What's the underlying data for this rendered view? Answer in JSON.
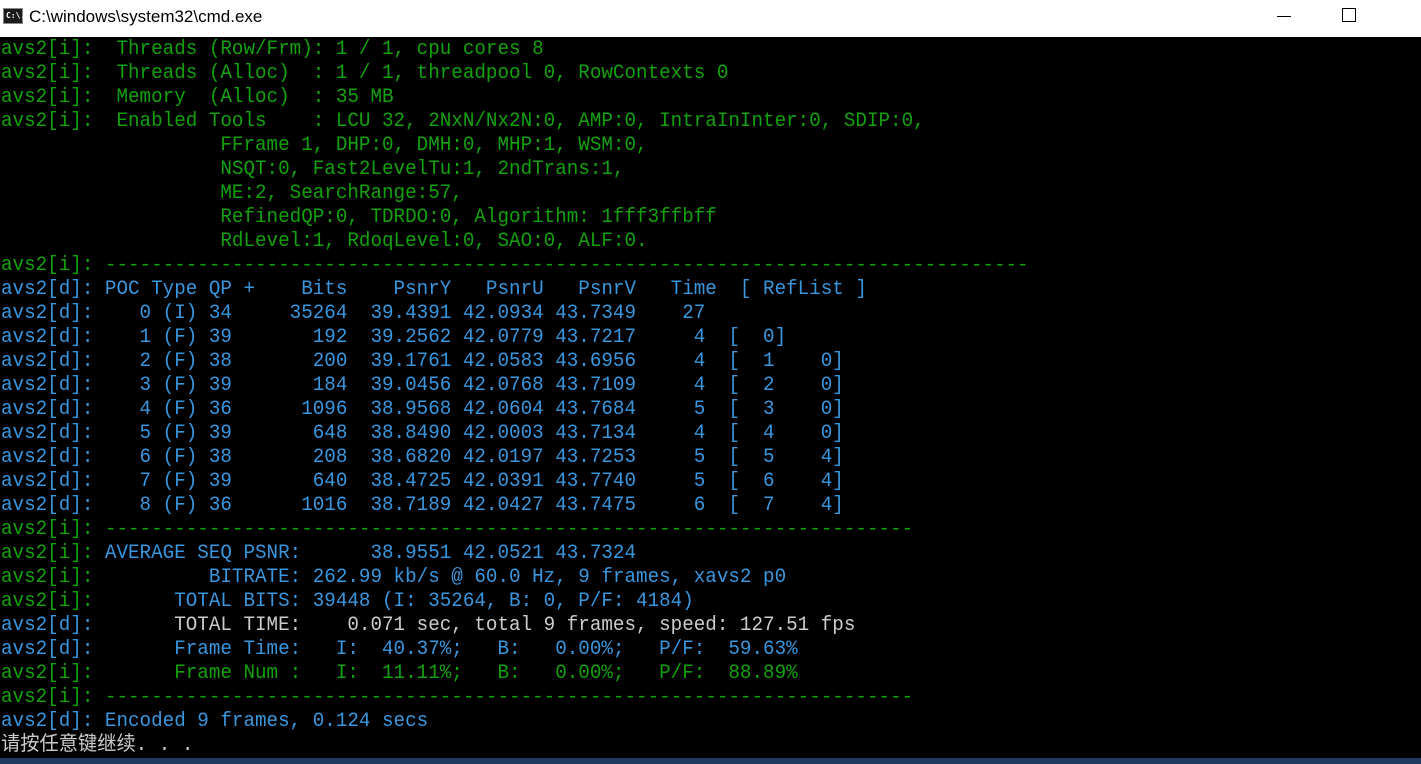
{
  "window": {
    "title": "C:\\windows\\system32\\cmd.exe",
    "icon": "cmd-icon",
    "icon_glyph": "C:\\."
  },
  "colors": {
    "bright_green": "#13a10e",
    "cyan": "#3a96dd",
    "white": "#cccccc",
    "green": "#13a10e"
  },
  "console": {
    "lines": [
      {
        "text": "avs2[i]:  Threads (Row/Frm): 1 / 1, cpu cores 8",
        "color": "#13a10e"
      },
      {
        "text": "avs2[i]:  Threads (Alloc)  : 1 / 1, threadpool 0, RowContexts 0",
        "color": "#13a10e"
      },
      {
        "text": "avs2[i]:  Memory  (Alloc)  : 35 MB",
        "color": "#13a10e"
      },
      {
        "text": "avs2[i]:  Enabled Tools    : LCU 32, 2NxN/Nx2N:0, AMP:0, IntraInInter:0, SDIP:0,",
        "color": "#13a10e"
      },
      {
        "text": "                   FFrame 1, DHP:0, DMH:0, MHP:1, WSM:0,",
        "color": "#13a10e"
      },
      {
        "text": "                   NSQT:0, Fast2LevelTu:1, 2ndTrans:1,",
        "color": "#13a10e"
      },
      {
        "text": "                   ME:2, SearchRange:57,",
        "color": "#13a10e"
      },
      {
        "text": "                   RefinedQP:0, TDRDO:0, Algorithm: 1fff3ffbff",
        "color": "#13a10e"
      },
      {
        "text": "                   RdLevel:1, RdoqLevel:0, SAO:0, ALF:0.",
        "color": "#13a10e"
      },
      {
        "text": "avs2[i]: --------------------------------------------------------------------------------",
        "color": "#13a10e"
      },
      {
        "text": "avs2[d]: POC Type QP +    Bits    PsnrY   PsnrU   PsnrV   Time  [ RefList ]",
        "color": "#3a96dd"
      },
      {
        "text": "avs2[d]:    0 (I) 34     35264  39.4391 42.0934 43.7349    27",
        "color": "#3a96dd"
      },
      {
        "text": "avs2[d]:    1 (F) 39       192  39.2562 42.0779 43.7217     4  [  0]",
        "color": "#3a96dd"
      },
      {
        "text": "avs2[d]:    2 (F) 38       200  39.1761 42.0583 43.6956     4  [  1    0]",
        "color": "#3a96dd"
      },
      {
        "text": "avs2[d]:    3 (F) 39       184  39.0456 42.0768 43.7109     4  [  2    0]",
        "color": "#3a96dd"
      },
      {
        "text": "avs2[d]:    4 (F) 36      1096  38.9568 42.0604 43.7684     5  [  3    0]",
        "color": "#3a96dd"
      },
      {
        "text": "avs2[d]:    5 (F) 39       648  38.8490 42.0003 43.7134     4  [  4    0]",
        "color": "#3a96dd"
      },
      {
        "text": "avs2[d]:    6 (F) 38       208  38.6820 42.0197 43.7253     5  [  5    4]",
        "color": "#3a96dd"
      },
      {
        "text": "avs2[d]:    7 (F) 39       640  38.4725 42.0391 43.7740     5  [  6    4]",
        "color": "#3a96dd"
      },
      {
        "text": "avs2[d]:    8 (F) 36      1016  38.7189 42.0427 43.7475     6  [  7    4]",
        "color": "#3a96dd"
      },
      {
        "text": "avs2[i]: ----------------------------------------------------------------------",
        "color": "#13a10e"
      },
      {
        "text": "avs2[i]: AVERAGE SEQ PSNR:      38.9551 42.0521 43.7324",
        "color": "#3a96dd",
        "prefix_color": "#13a10e"
      },
      {
        "text": "avs2[i]:          BITRATE: 262.99 kb/s @ 60.0 Hz, 9 frames, xavs2 p0",
        "color": "#3a96dd",
        "prefix_color": "#13a10e"
      },
      {
        "text": "avs2[i]:       TOTAL BITS: 39448 (I: 35264, B: 0, P/F: 4184)",
        "color": "#3a96dd",
        "prefix_color": "#13a10e"
      },
      {
        "text": "avs2[d]:       TOTAL TIME:    0.071 sec, total 9 frames, speed: 127.51 fps",
        "color": "#cccccc",
        "prefix_color": "#3a96dd"
      },
      {
        "text": "avs2[d]:       Frame Time:   I:  40.37%;   B:   0.00%;   P/F:  59.63%",
        "color": "#3a96dd"
      },
      {
        "text": "avs2[i]:       Frame Num :   I:  11.11%;   B:   0.00%;   P/F:  88.89%",
        "color": "#13a10e"
      },
      {
        "text": "avs2[i]: ----------------------------------------------------------------------",
        "color": "#13a10e"
      },
      {
        "text": "avs2[d]: Encoded 9 frames, 0.124 secs",
        "color": "#3a96dd",
        "suffix_color": "#cccccc"
      },
      {
        "text": "请按任意键继续. . .",
        "color": "#cccccc"
      }
    ]
  }
}
